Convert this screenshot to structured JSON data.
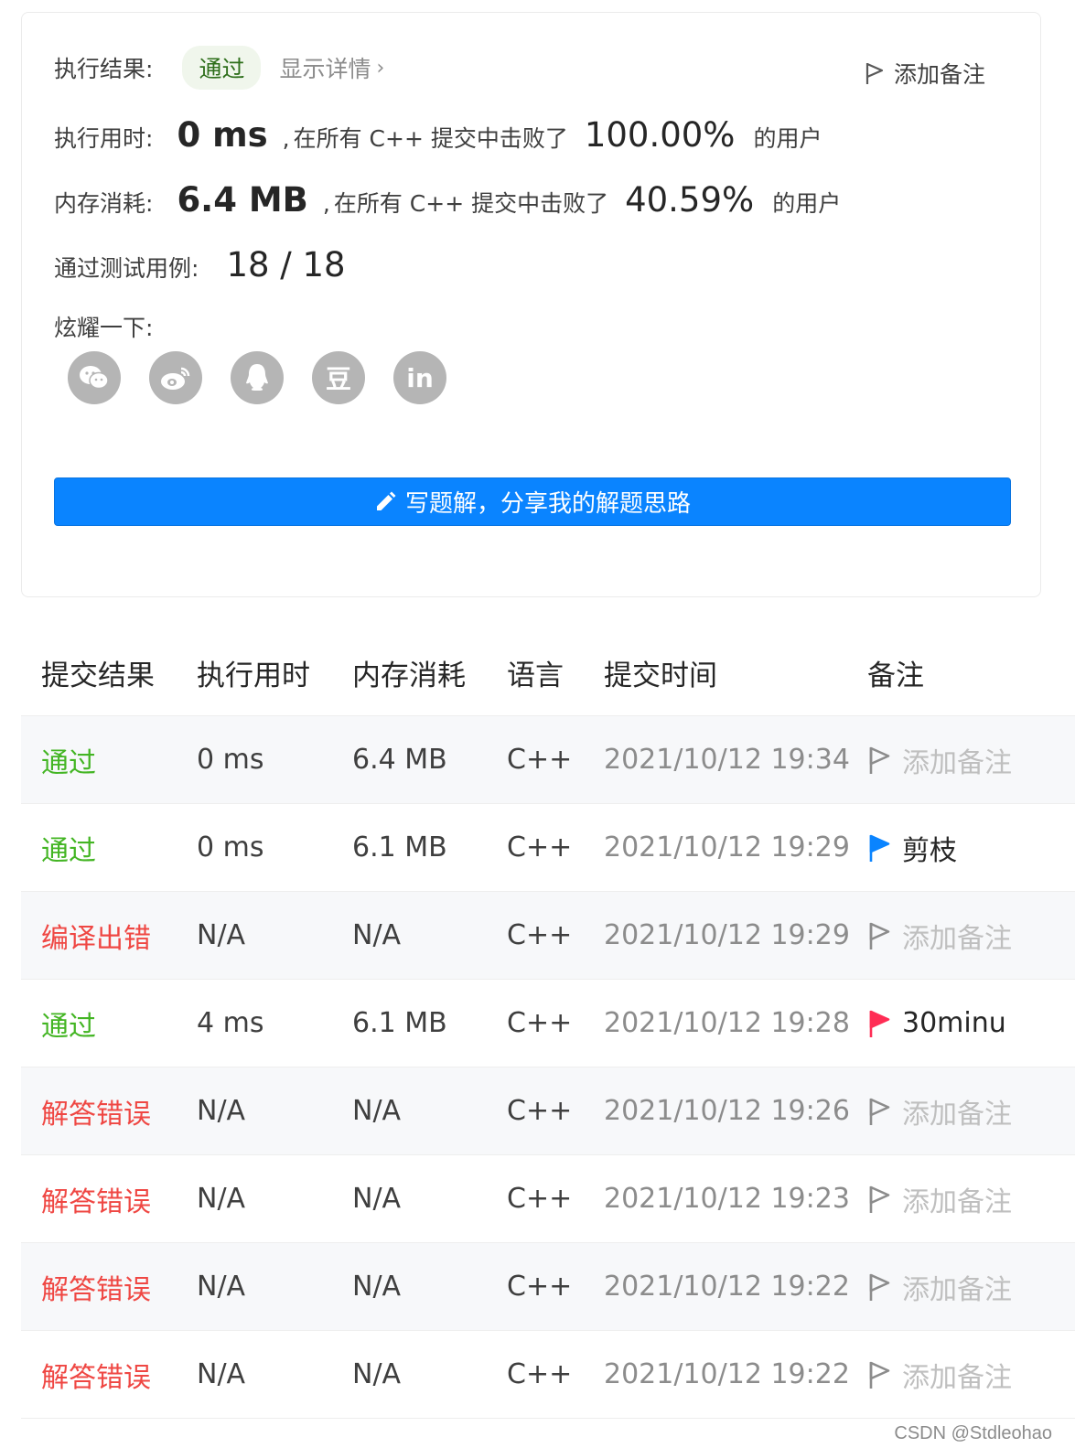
{
  "result": {
    "status_label": "执行结果:",
    "status_badge": "通过",
    "detail_link": "显示详情",
    "add_note": "添加备注",
    "runtime_label": "执行用时:",
    "runtime_value": "0 ms",
    "runtime_text": "在所有 C++ 提交中击败了",
    "runtime_percent": "100.00%",
    "runtime_suffix": "的用户",
    "memory_label": "内存消耗:",
    "memory_value": "6.4 MB",
    "memory_text": "在所有 C++ 提交中击败了",
    "memory_percent": "40.59%",
    "memory_suffix": "的用户",
    "tests_label": "通过测试用例:",
    "tests_value": "18 / 18",
    "share_label": "炫耀一下:",
    "share_icons": [
      "wechat-icon",
      "weibo-icon",
      "qq-icon",
      "douban-icon",
      "linkedin-icon"
    ],
    "share_douban_glyph": "豆",
    "share_linkedin_glyph": "in",
    "write_button": "写题解，分享我的解题思路"
  },
  "table": {
    "headers": [
      "提交结果",
      "执行用时",
      "内存消耗",
      "语言",
      "提交时间",
      "备注"
    ],
    "rows": [
      {
        "status": "通过",
        "status_type": "pass",
        "runtime": "0 ms",
        "memory": "6.4 MB",
        "lang": "C++",
        "time": "2021/10/12 19:34",
        "note": "添加备注",
        "note_type": "empty"
      },
      {
        "status": "通过",
        "status_type": "pass",
        "runtime": "0 ms",
        "memory": "6.1 MB",
        "lang": "C++",
        "time": "2021/10/12 19:29",
        "note": "剪枝",
        "note_type": "blue"
      },
      {
        "status": "编译出错",
        "status_type": "fail",
        "runtime": "N/A",
        "memory": "N/A",
        "lang": "C++",
        "time": "2021/10/12 19:29",
        "note": "添加备注",
        "note_type": "empty"
      },
      {
        "status": "通过",
        "status_type": "pass",
        "runtime": "4 ms",
        "memory": "6.1 MB",
        "lang": "C++",
        "time": "2021/10/12 19:28",
        "note": "30minu",
        "note_type": "red"
      },
      {
        "status": "解答错误",
        "status_type": "fail",
        "runtime": "N/A",
        "memory": "N/A",
        "lang": "C++",
        "time": "2021/10/12 19:26",
        "note": "添加备注",
        "note_type": "empty"
      },
      {
        "status": "解答错误",
        "status_type": "fail",
        "runtime": "N/A",
        "memory": "N/A",
        "lang": "C++",
        "time": "2021/10/12 19:23",
        "note": "添加备注",
        "note_type": "empty"
      },
      {
        "status": "解答错误",
        "status_type": "fail",
        "runtime": "N/A",
        "memory": "N/A",
        "lang": "C++",
        "time": "2021/10/12 19:22",
        "note": "添加备注",
        "note_type": "empty"
      },
      {
        "status": "解答错误",
        "status_type": "fail",
        "runtime": "N/A",
        "memory": "N/A",
        "lang": "C++",
        "time": "2021/10/12 19:22",
        "note": "添加备注",
        "note_type": "empty"
      }
    ]
  },
  "colors": {
    "pass": "#43b523",
    "fail": "#ef4743",
    "primary": "#0a84ff",
    "flag_blue": "#0a84ff",
    "flag_red": "#ff2d55",
    "flag_empty": "#8c8c8c"
  },
  "watermark": "CSDN @Stdleohao"
}
